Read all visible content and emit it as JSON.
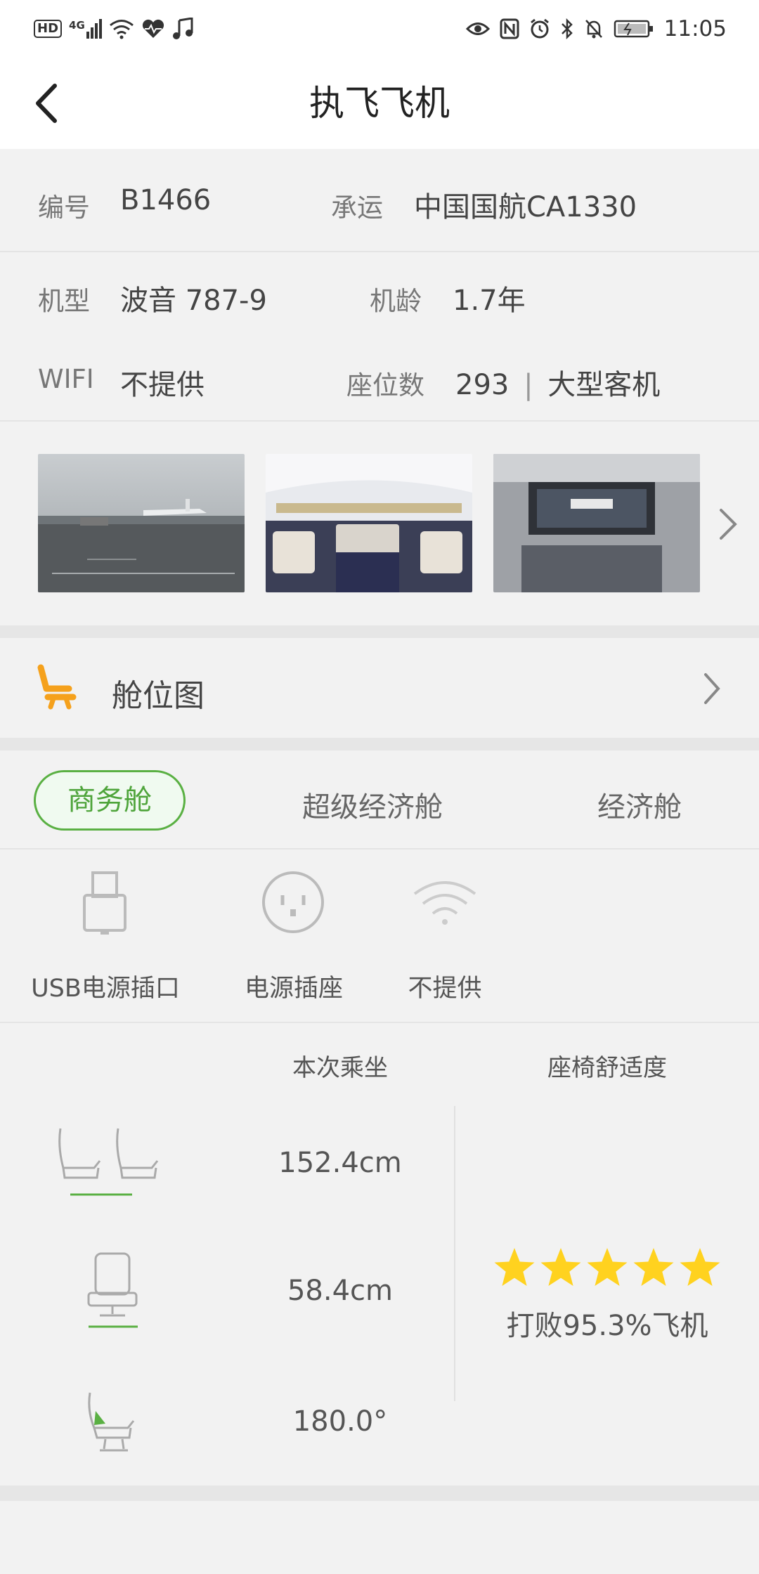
{
  "status": {
    "left_badge": "HD",
    "network": "4G",
    "time": "11:05"
  },
  "nav": {
    "title": "执飞飞机"
  },
  "info": {
    "reg_label": "编号",
    "reg_value": "B1466",
    "carrier_label": "承运",
    "carrier_value": "中国国航CA1330",
    "model_label": "机型",
    "model_value": "波音 787-9",
    "age_label": "机龄",
    "age_value": "1.7年",
    "wifi_label": "WIFI",
    "wifi_value": "不提供",
    "seats_label": "座位数",
    "seats_value": "293",
    "seats_divider": "|",
    "size_value": "大型客机"
  },
  "seatmap": {
    "label": "舱位图"
  },
  "cabins": {
    "tabs": [
      "商务舱",
      "超级经济舱",
      "经济舱"
    ],
    "active_index": 0
  },
  "amenities": [
    {
      "icon": "usb-icon",
      "label": "USB电源插口"
    },
    {
      "icon": "power-socket-icon",
      "label": "电源插座"
    },
    {
      "icon": "wifi-icon",
      "label": "不提供"
    }
  ],
  "comfort": {
    "col_current": "本次乘坐",
    "col_rating": "座椅舒适度",
    "pitch": "152.4cm",
    "width": "58.4cm",
    "recline": "180.0°",
    "stars": 5,
    "beat_text": "打败95.3%飞机"
  },
  "colors": {
    "accent_green": "#5ab043",
    "star_yellow": "#ffd21f",
    "seat_orange": "#f5a11c"
  }
}
